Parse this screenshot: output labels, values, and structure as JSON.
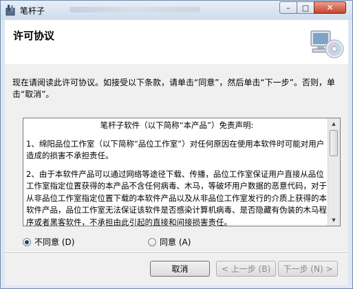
{
  "window": {
    "title": "笔杆子",
    "close_glyph": "✕",
    "min_glyph": "–",
    "max_glyph": "□"
  },
  "header": {
    "title": "许可协议"
  },
  "instruction": "现在请阅读此许可协议。如接受以下条款，请单击“同意”，然后单击“下一步”。否则，单击“取消”。",
  "license": {
    "heading": "笔杆子软件（以下简称“本产品”）免责声明:",
    "paragraphs": [
      "1、绵阳品位工作室（以下简称“品位工作室”）对任何原因在使用本软件时可能对用户造成的损害不承担责任。",
      "2、由于本软件产品可以通过网络等途径下载、传播，品位工作室保证用户直接从品位工作室指定位置获得的本产品不含任何病毒、木马，等破坏用户数据的恶意代码，对于从非品位工作室指定位置下载的本软件产品以及从非品位工作室发行的介质上获得的本软件产品，品位工作室无法保证该软件是否感染计算机病毒、是否隐藏有伪装的木马程序或者黑客软件，不承担由此引起的直接和间接损害责任。"
    ]
  },
  "options": {
    "disagree_label": "不同意 (D)",
    "agree_label": "同意 (A)",
    "selected": "disagree"
  },
  "buttons": {
    "cancel": "取消",
    "back": "< 上一步 (B)",
    "next": "下一步 (N) >"
  },
  "icons": {
    "app": "pen-icon",
    "header": "computer-cd-icon",
    "scroll_up": "scroll-up-arrow-icon",
    "scroll_down": "scroll-down-arrow-icon"
  },
  "colors": {
    "selected_radio": "#1f3f72",
    "close_button": "#c8442a"
  }
}
